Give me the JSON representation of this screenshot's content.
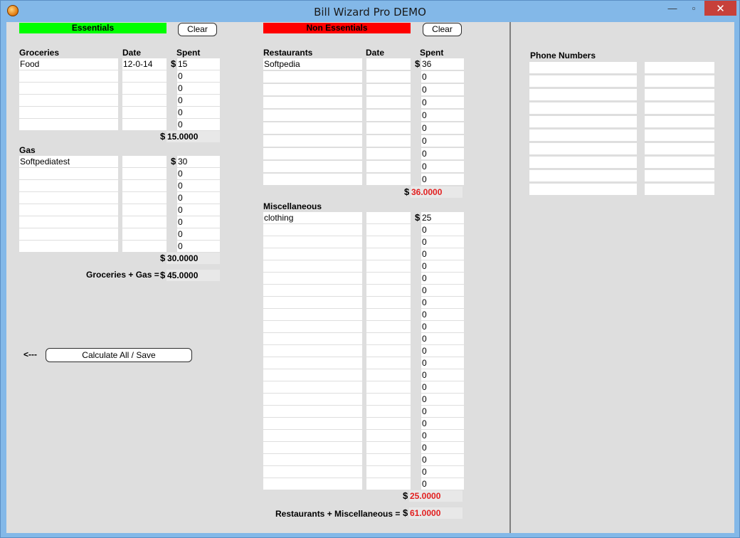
{
  "window": {
    "title": "Bill Wizard Pro DEMO",
    "minimize": "—",
    "maximize": "▫",
    "close": "✕"
  },
  "essentials": {
    "tag": "Essentials",
    "tag_color": "#00ff00",
    "clear_label": "Clear",
    "groceries": {
      "header": "Groceries",
      "date_header": "Date",
      "spent_header": "Spent",
      "rows": [
        {
          "name": "Food",
          "date": "12-0-14",
          "spent": "15"
        },
        {
          "name": "",
          "date": "",
          "spent": "0"
        },
        {
          "name": "",
          "date": "",
          "spent": "0"
        },
        {
          "name": "",
          "date": "",
          "spent": "0"
        },
        {
          "name": "",
          "date": "",
          "spent": "0"
        },
        {
          "name": "",
          "date": "",
          "spent": "0"
        }
      ],
      "total": "15.0000"
    },
    "gas": {
      "header": "Gas",
      "rows": [
        {
          "name": "Softpediatest",
          "date": "",
          "spent": "30"
        },
        {
          "name": "",
          "date": "",
          "spent": "0"
        },
        {
          "name": "",
          "date": "",
          "spent": "0"
        },
        {
          "name": "",
          "date": "",
          "spent": "0"
        },
        {
          "name": "",
          "date": "",
          "spent": "0"
        },
        {
          "name": "",
          "date": "",
          "spent": "0"
        },
        {
          "name": "",
          "date": "",
          "spent": "0"
        },
        {
          "name": "",
          "date": "",
          "spent": "0"
        }
      ],
      "total": "30.0000"
    },
    "combined_label": "Groceries + Gas =",
    "combined_total": "45.0000"
  },
  "currency_symbol": "$",
  "calculate": {
    "arrow": "<---",
    "label": "Calculate All / Save"
  },
  "non_essentials": {
    "tag": "Non Essentials",
    "tag_color": "#ff0000",
    "clear_label": "Clear",
    "restaurants": {
      "header": "Restaurants",
      "date_header": "Date",
      "spent_header": "Spent",
      "rows": [
        {
          "name": "Softpedia",
          "date": "",
          "spent": "36"
        },
        {
          "name": "",
          "date": "",
          "spent": "0"
        },
        {
          "name": "",
          "date": "",
          "spent": "0"
        },
        {
          "name": "",
          "date": "",
          "spent": "0"
        },
        {
          "name": "",
          "date": "",
          "spent": "0"
        },
        {
          "name": "",
          "date": "",
          "spent": "0"
        },
        {
          "name": "",
          "date": "",
          "spent": "0"
        },
        {
          "name": "",
          "date": "",
          "spent": "0"
        },
        {
          "name": "",
          "date": "",
          "spent": "0"
        },
        {
          "name": "",
          "date": "",
          "spent": "0"
        }
      ],
      "total": "36.0000"
    },
    "miscellaneous": {
      "header": "Miscellaneous",
      "rows": [
        {
          "name": "clothing",
          "date": "",
          "spent": "25"
        },
        {
          "name": "",
          "date": "",
          "spent": "0"
        },
        {
          "name": "",
          "date": "",
          "spent": "0"
        },
        {
          "name": "",
          "date": "",
          "spent": "0"
        },
        {
          "name": "",
          "date": "",
          "spent": "0"
        },
        {
          "name": "",
          "date": "",
          "spent": "0"
        },
        {
          "name": "",
          "date": "",
          "spent": "0"
        },
        {
          "name": "",
          "date": "",
          "spent": "0"
        },
        {
          "name": "",
          "date": "",
          "spent": "0"
        },
        {
          "name": "",
          "date": "",
          "spent": "0"
        },
        {
          "name": "",
          "date": "",
          "spent": "0"
        },
        {
          "name": "",
          "date": "",
          "spent": "0"
        },
        {
          "name": "",
          "date": "",
          "spent": "0"
        },
        {
          "name": "",
          "date": "",
          "spent": "0"
        },
        {
          "name": "",
          "date": "",
          "spent": "0"
        },
        {
          "name": "",
          "date": "",
          "spent": "0"
        },
        {
          "name": "",
          "date": "",
          "spent": "0"
        },
        {
          "name": "",
          "date": "",
          "spent": "0"
        },
        {
          "name": "",
          "date": "",
          "spent": "0"
        },
        {
          "name": "",
          "date": "",
          "spent": "0"
        },
        {
          "name": "",
          "date": "",
          "spent": "0"
        },
        {
          "name": "",
          "date": "",
          "spent": "0"
        },
        {
          "name": "",
          "date": "",
          "spent": "0"
        }
      ],
      "total": "25.0000"
    },
    "combined_label": "Restaurants + Miscellaneous =",
    "combined_total": "61.0000"
  },
  "phone_numbers": {
    "header": "Phone Numbers",
    "rows": [
      {
        "name": "",
        "number": ""
      },
      {
        "name": "",
        "number": ""
      },
      {
        "name": "",
        "number": ""
      },
      {
        "name": "",
        "number": ""
      },
      {
        "name": "",
        "number": ""
      },
      {
        "name": "",
        "number": ""
      },
      {
        "name": "",
        "number": ""
      },
      {
        "name": "",
        "number": ""
      },
      {
        "name": "",
        "number": ""
      },
      {
        "name": "",
        "number": ""
      }
    ]
  }
}
